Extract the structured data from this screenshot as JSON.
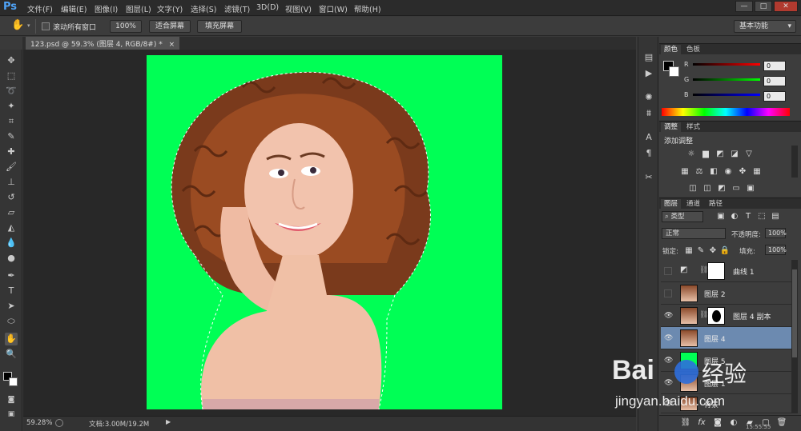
{
  "app": {
    "logo": "Ps",
    "menu": [
      "文件(F)",
      "编辑(E)",
      "图像(I)",
      "图层(L)",
      "文字(Y)",
      "选择(S)",
      "滤镜(T)",
      "3D(D)",
      "视图(V)",
      "窗口(W)",
      "帮助(H)"
    ],
    "window_buttons": [
      "—",
      "□",
      "✕"
    ]
  },
  "options_bar": {
    "scroll_all_label": "滚动所有窗口",
    "zoom_100": "100%",
    "fit_screen": "适合屏幕",
    "fill_screen": "填充屏幕",
    "workspace": "基本功能"
  },
  "document": {
    "tab_title": "123.psd @ 59.3% (图层 4, RGB/8#) *",
    "tab_close": "×"
  },
  "canvas": {
    "background_color": "#00ff55"
  },
  "status": {
    "zoom": "59.28%",
    "doc_info": "文档:3.00M/19.2M"
  },
  "color_panel": {
    "tabs": [
      "颜色",
      "色板"
    ],
    "r_label": "R",
    "g_label": "G",
    "b_label": "B",
    "r_value": "0",
    "g_value": "0",
    "b_value": "0"
  },
  "adjust_panel": {
    "tabs": [
      "调整",
      "样式"
    ],
    "title": "添加调整"
  },
  "layers_panel": {
    "tabs": [
      "图层",
      "通道",
      "路径"
    ],
    "filter_kind": "类型",
    "blend_mode": "正常",
    "opacity_label": "不透明度:",
    "opacity_value": "100%",
    "lock_label": "锁定:",
    "fill_label": "填充:",
    "fill_value": "100%",
    "layers": [
      {
        "name": "曲线 1",
        "visible": false,
        "selected": false,
        "type": "adjustment"
      },
      {
        "name": "图层 2",
        "visible": false,
        "selected": false,
        "type": "image"
      },
      {
        "name": "图层 4 副本",
        "visible": true,
        "selected": false,
        "type": "masked"
      },
      {
        "name": "图层 4",
        "visible": true,
        "selected": true,
        "type": "image"
      },
      {
        "name": "图层 5",
        "visible": true,
        "selected": false,
        "type": "image"
      },
      {
        "name": "图层 1",
        "visible": true,
        "selected": false,
        "type": "image"
      },
      {
        "name": "背景",
        "visible": true,
        "selected": false,
        "type": "image"
      }
    ]
  },
  "watermark": {
    "brand": "Bai",
    "brand_sub": "经验",
    "url": "jingyan.baidu.com"
  },
  "clock": "15:55:55"
}
